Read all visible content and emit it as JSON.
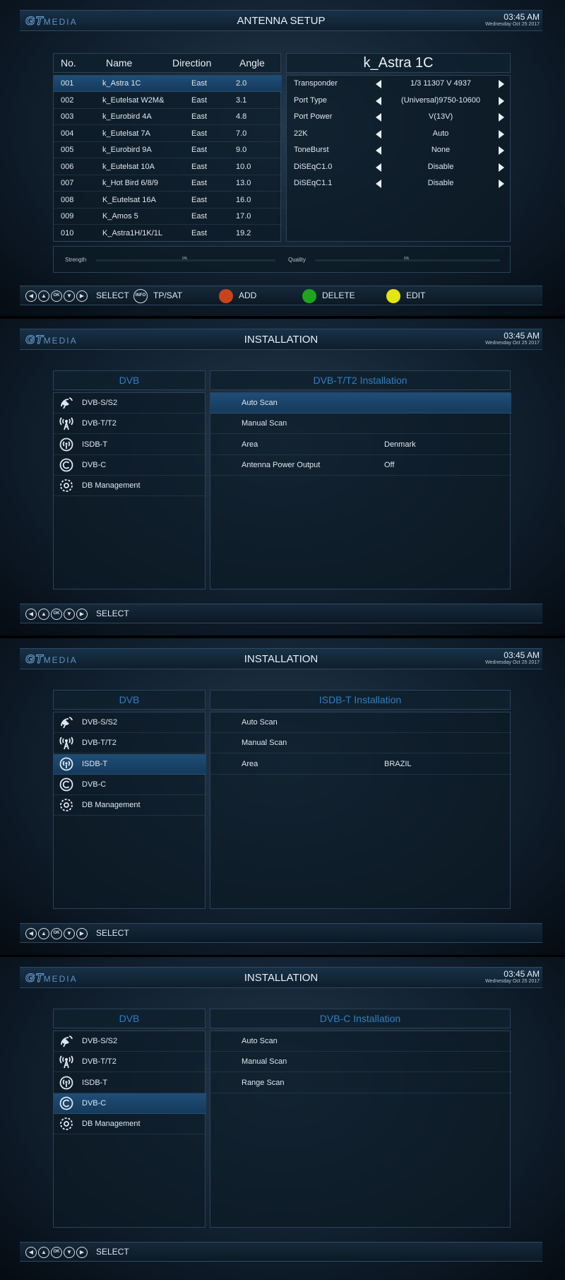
{
  "brand": {
    "logo_gt": "GT",
    "logo_media": "MEDIA"
  },
  "clock": {
    "time": "03:45 AM",
    "date": "Wednesday Oct 25 2017"
  },
  "antenna": {
    "title": "ANTENNA SETUP",
    "columns": {
      "no": "No.",
      "name": "Name",
      "direction": "Direction",
      "angle": "Angle"
    },
    "satellites": [
      {
        "no": "001",
        "name": "k_Astra 1C",
        "direction": "East",
        "angle": "2.0"
      },
      {
        "no": "002",
        "name": "k_Eutelsat W2M&",
        "direction": "East",
        "angle": "3.1"
      },
      {
        "no": "003",
        "name": "k_Eurobird 4A",
        "direction": "East",
        "angle": "4.8"
      },
      {
        "no": "004",
        "name": "k_Eutelsat 7A",
        "direction": "East",
        "angle": "7.0"
      },
      {
        "no": "005",
        "name": "k_Eurobird 9A",
        "direction": "East",
        "angle": "9.0"
      },
      {
        "no": "006",
        "name": "k_Eutelsat 10A",
        "direction": "East",
        "angle": "10.0"
      },
      {
        "no": "007",
        "name": "k_Hot Bird 6/8/9",
        "direction": "East",
        "angle": "13.0"
      },
      {
        "no": "008",
        "name": "K_Eutelsat 16A",
        "direction": "East",
        "angle": "16.0"
      },
      {
        "no": "009",
        "name": "K_Amos 5",
        "direction": "East",
        "angle": "17.0"
      },
      {
        "no": "010",
        "name": "K_Astra1H/1K/1L",
        "direction": "East",
        "angle": "19.2"
      }
    ],
    "selected_sat_name": "k_Astra 1C",
    "params": [
      {
        "label": "Transponder",
        "value": "1/3 11307 V 4937"
      },
      {
        "label": "Port Type",
        "value": "(Universal)9750-10600"
      },
      {
        "label": "Port Power",
        "value": "V(13V)"
      },
      {
        "label": "22K",
        "value": "Auto"
      },
      {
        "label": "ToneBurst",
        "value": "None"
      },
      {
        "label": "DiSEqC1.0",
        "value": "Disable"
      },
      {
        "label": "DiSEqC1.1",
        "value": "Disable"
      }
    ],
    "strength": {
      "label": "Strength",
      "pct_text": "0%",
      "value": 0
    },
    "quality": {
      "label": "Quality",
      "pct_text": "0%",
      "value": 0
    },
    "bottom": {
      "select": "SELECT",
      "info_icon": "INFO",
      "tpsat": "TP/SAT",
      "add": "ADD",
      "delete": "DELETE",
      "edit": "EDIT",
      "colors": {
        "red": "#c9441a",
        "green": "#1da51d",
        "yellow": "#e5e50f"
      }
    }
  },
  "installation": {
    "title": "INSTALLATION",
    "left_header": "DVB",
    "menu": [
      {
        "label": "DVB-S/S2",
        "icon": "satellite-dish-icon"
      },
      {
        "label": "DVB-T/T2",
        "icon": "antenna-tower-icon"
      },
      {
        "label": "ISDB-T",
        "icon": "broadcast-signal-icon"
      },
      {
        "label": "DVB-C",
        "icon": "cable-c-icon"
      },
      {
        "label": "DB Management",
        "icon": "database-gear-icon"
      }
    ],
    "bottom_select": "SELECT",
    "ok_icon": "OK",
    "screens": [
      {
        "header": "DVB-T/T2 Installation",
        "options": [
          {
            "label": "Auto Scan",
            "value": ""
          },
          {
            "label": "Manual Scan",
            "value": ""
          },
          {
            "label": "Area",
            "value": "Denmark"
          },
          {
            "label": "Antenna Power Output",
            "value": "Off"
          }
        ]
      },
      {
        "header": "ISDB-T Installation",
        "options": [
          {
            "label": "Auto Scan",
            "value": ""
          },
          {
            "label": "Manual Scan",
            "value": ""
          },
          {
            "label": "Area",
            "value": "BRAZIL"
          }
        ]
      },
      {
        "header": "DVB-C Installation",
        "options": [
          {
            "label": "Auto Scan",
            "value": ""
          },
          {
            "label": "Manual Scan",
            "value": ""
          },
          {
            "label": "Range Scan",
            "value": ""
          }
        ]
      }
    ]
  },
  "colors": {
    "accent": "#2f7fc1",
    "selection": "#1f4e78"
  }
}
